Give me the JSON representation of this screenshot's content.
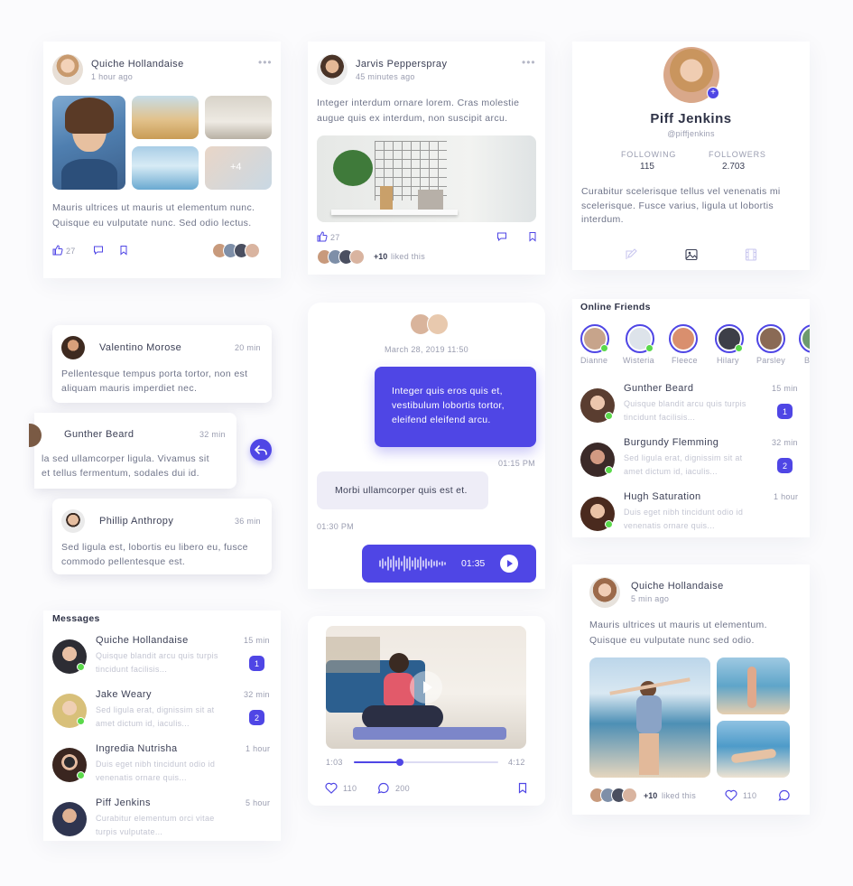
{
  "colors": {
    "accent": "#4f46e5",
    "online": "#5ad94a"
  },
  "post1": {
    "author": "Quiche Hollandaise",
    "time": "1 hour ago",
    "more_count": "+4",
    "text1": "Mauris ultrices ut mauris ut elementum nunc.",
    "text2": "Quisque eu vulputate nunc. Sed odio lectus.",
    "likes": "27"
  },
  "post2": {
    "author": "Jarvis Pepperspray",
    "time": "45 minutes ago",
    "text1": "Integer interdum ornare lorem. Cras molestie",
    "text2": "augue quis ex interdum, non suscipit arcu.",
    "likes": "27",
    "liked_this": "+10",
    "liked_suffix": "liked this"
  },
  "profile": {
    "name": "Piff Jenkins",
    "handle": "@piffjenkins",
    "following_label": "FOLLOWING",
    "following": "115",
    "followers_label": "FOLLOWERS",
    "followers": "2.703",
    "bio1": "Curabitur scelerisque tellus vel venenatis mi",
    "bio2": "scelerisque. Fusce varius, ligula ut lobortis",
    "bio3": "interdum."
  },
  "comments": [
    {
      "name": "Valentino Morose",
      "time": "20 min",
      "l1": "Pellentesque tempus porta tortor, non est",
      "l2": "aliquam mauris imperdiet nec."
    },
    {
      "name": "Gunther Beard",
      "time": "32 min",
      "l1": "la sed ullamcorper ligula. Vivamus sit",
      "l2": "et tellus fermentum, sodales dui id."
    },
    {
      "name": "Phillip Anthropy",
      "time": "36 min",
      "l1": "Sed ligula est, lobortis eu libero eu, fusce",
      "l2": "commodo pellentesque est."
    }
  ],
  "chat": {
    "date": "March 28, 2019 11:50",
    "msg1_l1": "Integer quis eros quis et,",
    "msg1_l2": "vestibulum lobortis tortor,",
    "msg1_l3": "eleifend eleifend arcu.",
    "time1": "01:15 PM",
    "msg2": "Morbi ullamcorper quis est et.",
    "time2": "01:30 PM",
    "voice_duration": "01:35"
  },
  "online": {
    "title": "Online Friends",
    "friends": [
      "Dianne",
      "Wisteria",
      "Fleece",
      "Hilary",
      "Parsley",
      "B"
    ]
  },
  "friend_msgs": [
    {
      "name": "Gunther Beard",
      "time": "15 min",
      "l1": "Quisque blandit arcu quis turpis",
      "l2": "tincidunt facilisis...",
      "badge": "1"
    },
    {
      "name": "Burgundy Flemming",
      "time": "32 min",
      "l1": "Sed ligula erat, dignissim sit at",
      "l2": "amet dictum id, iaculis...",
      "badge": "2"
    },
    {
      "name": "Hugh Saturation",
      "time": "1 hour",
      "l1": "Duis eget nibh tincidunt odio id",
      "l2": "venenatis ornare quis..."
    }
  ],
  "messages": {
    "title": "Messages",
    "items": [
      {
        "name": "Quiche Hollandaise",
        "time": "15 min",
        "l1": "Quisque blandit arcu quis turpis",
        "l2": "tincidunt facilisis...",
        "badge": "1"
      },
      {
        "name": "Jake Weary",
        "time": "32 min",
        "l1": "Sed ligula erat, dignissim sit at",
        "l2": "amet dictum id, iaculis...",
        "badge": "2"
      },
      {
        "name": "Ingredia Nutrisha",
        "time": "1 hour",
        "l1": "Duis eget nibh tincidunt odio id",
        "l2": "venenatis ornare quis..."
      },
      {
        "name": "Piff Jenkins",
        "time": "5 hour",
        "l1": "Curabitur elementum orci vitae",
        "l2": "turpis vulputate..."
      }
    ]
  },
  "video": {
    "current": "1:03",
    "total": "4:12",
    "progress": 0.32,
    "likes": "110",
    "comments": "200"
  },
  "post3": {
    "author": "Quiche Hollandaise",
    "time": "5 min ago",
    "text1": "Mauris ultrices ut mauris ut elementum.",
    "text2": "Quisque eu vulputate nunc sed odio.",
    "liked_this": "+10",
    "liked_suffix": "liked this",
    "likes": "110"
  }
}
